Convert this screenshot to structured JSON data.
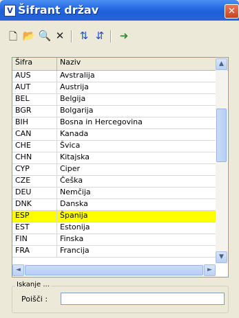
{
  "window": {
    "app_icon": "V",
    "title": "Šifrant držav",
    "close_glyph": "✕"
  },
  "toolbar": {
    "buttons": [
      {
        "name": "new-icon",
        "glyph": "🗋"
      },
      {
        "name": "open-folder-icon",
        "glyph": "📂"
      },
      {
        "name": "preview-icon",
        "glyph": "🔍"
      },
      {
        "name": "delete-icon",
        "glyph": "✕"
      },
      {
        "name": "sort-descending-icon",
        "glyph": "⇅"
      },
      {
        "name": "sort-ascending-icon",
        "glyph": "⇵"
      },
      {
        "name": "exit-icon",
        "glyph": "➜"
      }
    ]
  },
  "grid": {
    "columns": [
      "Šifra",
      "Naziv"
    ],
    "rows": [
      {
        "code": "AUS",
        "name": "Avstralija"
      },
      {
        "code": "AUT",
        "name": "Austrija"
      },
      {
        "code": "BEL",
        "name": "Belgija"
      },
      {
        "code": "BGR",
        "name": "Bolgarija"
      },
      {
        "code": "BIH",
        "name": "Bosna in Hercegovina"
      },
      {
        "code": "CAN",
        "name": "Kanada"
      },
      {
        "code": "CHE",
        "name": "Švica"
      },
      {
        "code": "CHN",
        "name": "Kitajska"
      },
      {
        "code": "CYP",
        "name": "Ciper"
      },
      {
        "code": "CZE",
        "name": "Češka"
      },
      {
        "code": "DEU",
        "name": "Nemčija"
      },
      {
        "code": "DNK",
        "name": "Danska"
      },
      {
        "code": "ESP",
        "name": "Španija"
      },
      {
        "code": "EST",
        "name": "Estonija"
      },
      {
        "code": "FIN",
        "name": "Finska"
      },
      {
        "code": "FRA",
        "name": "Francija"
      }
    ],
    "selected_code": "ESP",
    "selected_color": "#ffff00"
  },
  "scroll": {
    "up": "▲",
    "down": "▼",
    "left": "◄",
    "right": "►"
  },
  "search": {
    "group_title": "Iskanje ...",
    "label": "Poišči :",
    "value": ""
  }
}
